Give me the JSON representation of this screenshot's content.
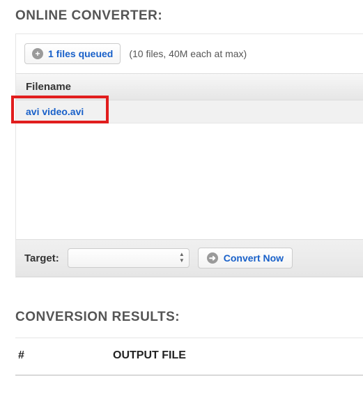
{
  "converter": {
    "section_title": "ONLINE CONVERTER:",
    "queue_button_label": "1 files queued",
    "limits_text": "(10 files, 40M each at max)",
    "filename_header": "Filename",
    "files": [
      {
        "name": "avi video.avi"
      }
    ],
    "target_label": "Target:",
    "target_value": "",
    "convert_button_label": "Convert Now"
  },
  "results": {
    "section_title": "CONVERSION RESULTS:",
    "col_num": "#",
    "col_output": "OUTPUT FILE"
  },
  "icons": {
    "plus": "+",
    "arrow": "➜"
  }
}
